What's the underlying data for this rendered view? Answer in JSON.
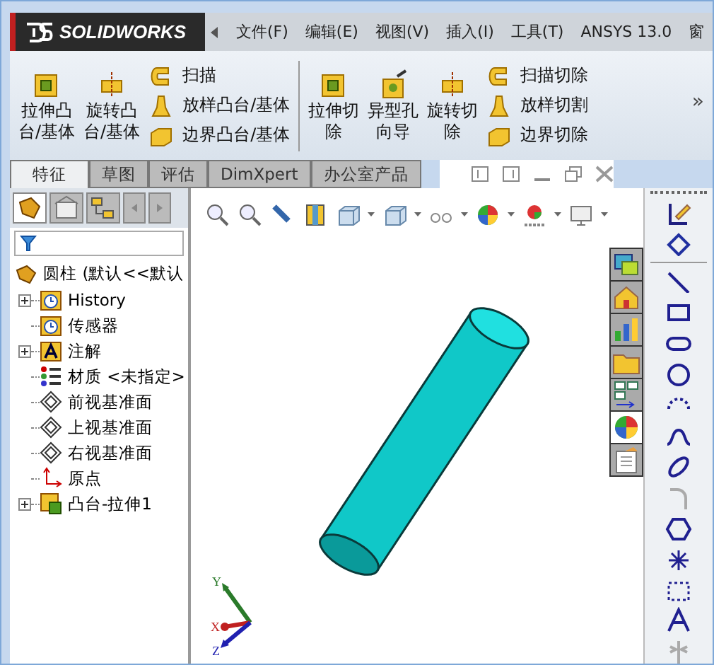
{
  "app": {
    "logo": "SOLIDWORKS"
  },
  "menu": [
    "文件(F)",
    "编辑(E)",
    "视图(V)",
    "插入(I)",
    "工具(T)",
    "ANSYS 13.0",
    "窗"
  ],
  "ribbon": {
    "groups": [
      {
        "big": [
          {
            "lines": [
              "拉伸凸",
              "台/基体"
            ],
            "kind": "extrude"
          },
          {
            "lines": [
              "旋转凸",
              "台/基体"
            ],
            "kind": "revolve"
          }
        ],
        "small": [
          {
            "label": "扫描",
            "kind": "sweep"
          },
          {
            "label": "放样凸台/基体",
            "kind": "loft"
          },
          {
            "label": "边界凸台/基体",
            "kind": "boundary"
          }
        ]
      },
      {
        "big": [
          {
            "lines": [
              "拉伸切",
              "除"
            ],
            "kind": "extrude"
          },
          {
            "lines": [
              "异型孔",
              "向导"
            ],
            "kind": "hole"
          },
          {
            "lines": [
              "旋转切",
              "除"
            ],
            "kind": "revolve"
          }
        ],
        "small": [
          {
            "label": "扫描切除",
            "kind": "sweep"
          },
          {
            "label": "放样切割",
            "kind": "loft"
          },
          {
            "label": "边界切除",
            "kind": "boundary"
          }
        ]
      }
    ],
    "more": "»"
  },
  "tabs": [
    {
      "label": "特征",
      "selected": true
    },
    {
      "label": "草图",
      "selected": false
    },
    {
      "label": "评估",
      "selected": false
    },
    {
      "label": "DimXpert",
      "selected": false
    },
    {
      "label": "办公室产品",
      "selected": false
    }
  ],
  "tree": {
    "root": "圆柱  (默认<<默认",
    "items": [
      {
        "label": "History",
        "kind": "history",
        "expandable": true
      },
      {
        "label": "传感器",
        "kind": "sensor",
        "expandable": false
      },
      {
        "label": "注解",
        "kind": "annotation",
        "expandable": true
      },
      {
        "label": "材质 <未指定>",
        "kind": "material",
        "expandable": false
      },
      {
        "label": "前视基准面",
        "kind": "plane",
        "expandable": false
      },
      {
        "label": "上视基准面",
        "kind": "plane",
        "expandable": false
      },
      {
        "label": "右视基准面",
        "kind": "plane",
        "expandable": false
      },
      {
        "label": "原点",
        "kind": "origin",
        "expandable": false
      },
      {
        "label": "凸台-拉伸1",
        "kind": "feature",
        "expandable": true
      }
    ]
  },
  "triad": {
    "x": "X",
    "y": "Y",
    "z": "Z"
  }
}
